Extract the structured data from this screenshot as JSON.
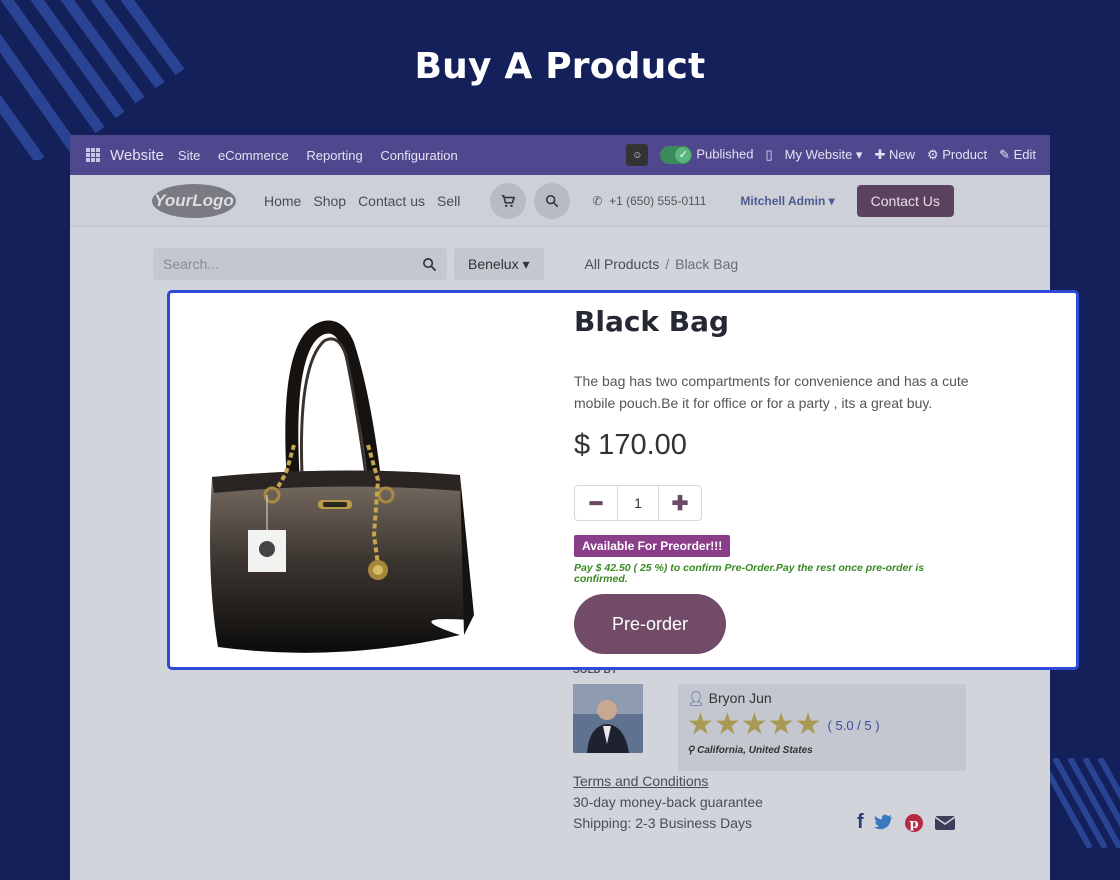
{
  "page": {
    "title": "Buy A Product"
  },
  "topbar": {
    "brand": "Website",
    "menu": [
      "Site",
      "eCommerce",
      "Reporting",
      "Configuration"
    ],
    "published": "Published",
    "my_website": "My Website",
    "new": "New",
    "product": "Product",
    "edit": "Edit"
  },
  "navbar": {
    "logo": "YourLogo",
    "links": [
      "Home",
      "Shop",
      "Contact us",
      "Sell"
    ],
    "phone": "+1 (650) 555-0111",
    "user": "Mitchell Admin",
    "contact_button": "Contact Us"
  },
  "search": {
    "placeholder": "Search...",
    "pricelist": "Benelux"
  },
  "breadcrumb": {
    "parent": "All Products",
    "separator": "/",
    "current": "Black Bag"
  },
  "product": {
    "name": "Black Bag",
    "description": "The bag has two compartments for convenience and has a cute mobile pouch.Be it for office or for a party , its a great buy.",
    "price": "$ 170.00",
    "quantity": "1",
    "preorder_badge": "Available For Preorder!!!",
    "pay_note": "Pay $ 42.50 ( 25 %) to confirm Pre-Order.Pay the rest once pre-order is confirmed.",
    "preorder_button": "Pre-order"
  },
  "seller": {
    "heading": "SOLD BY",
    "name": "Bryon Jun",
    "rating": "( 5.0 / 5 )",
    "stars": 5,
    "location": "California, United States"
  },
  "footer_info": {
    "terms": "Terms and Conditions",
    "guarantee": "30-day money-back guarantee",
    "shipping": "Shipping: 2-3 Business Days"
  },
  "colors": {
    "background": "#13205a",
    "highlight_border": "#2f4ad6",
    "preorder_button": "#714b67",
    "badge": "#8a3e8a",
    "note": "#3a8a24"
  }
}
